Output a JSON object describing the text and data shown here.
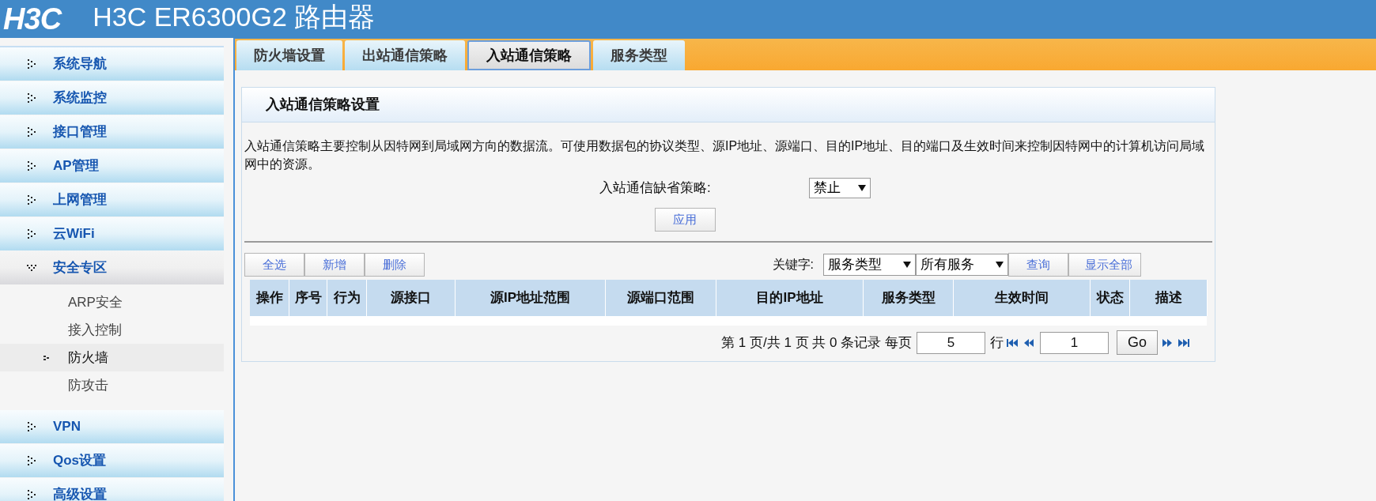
{
  "header": {
    "logo": "H3C",
    "title": "H3C ER6300G2 路由器"
  },
  "sidebar": {
    "items": [
      {
        "label": "系统导航",
        "expanded": false
      },
      {
        "label": "系统监控",
        "expanded": false
      },
      {
        "label": "接口管理",
        "expanded": false
      },
      {
        "label": "AP管理",
        "expanded": false
      },
      {
        "label": "上网管理",
        "expanded": false
      },
      {
        "label": "云WiFi",
        "expanded": false
      },
      {
        "label": "安全专区",
        "expanded": true,
        "children": [
          {
            "label": "ARP安全",
            "selected": false
          },
          {
            "label": "接入控制",
            "selected": false
          },
          {
            "label": "防火墙",
            "selected": true
          },
          {
            "label": "防攻击",
            "selected": false
          }
        ]
      },
      {
        "label": "VPN",
        "expanded": false
      },
      {
        "label": "Qos设置",
        "expanded": false
      },
      {
        "label": "高级设置",
        "expanded": false
      }
    ]
  },
  "tabs": [
    {
      "label": "防火墙设置",
      "selected": false
    },
    {
      "label": "出站通信策略",
      "selected": false
    },
    {
      "label": "入站通信策略",
      "selected": true
    },
    {
      "label": "服务类型",
      "selected": false
    }
  ],
  "panel": {
    "title": "入站通信策略设置",
    "description": "入站通信策略主要控制从因特网到局域网方向的数据流。可使用数据包的协议类型、源IP地址、源端口、目的IP地址、目的端口及生效时间来控制因特网中的计算机访问局域网中的资源。",
    "default_policy": {
      "label": "入站通信缺省策略:",
      "value": "禁止"
    },
    "apply_button": "应用",
    "actions": [
      "全选",
      "新增",
      "删除"
    ],
    "filter": {
      "label": "关键字:",
      "field": "服务类型",
      "value": "所有服务",
      "search_button": "查询",
      "show_all_button": "显示全部"
    },
    "table": {
      "columns": [
        "操作",
        "序号",
        "行为",
        "源接口",
        "源IP地址范围",
        "源端口范围",
        "目的IP地址",
        "服务类型",
        "生效时间",
        "状态",
        "描述"
      ]
    },
    "pagination": {
      "summary": "第 1 页/共 1 页 共 0 条记录 每页",
      "per_page": "5",
      "rows_label": "行",
      "page": "1",
      "go_button": "Go"
    }
  }
}
